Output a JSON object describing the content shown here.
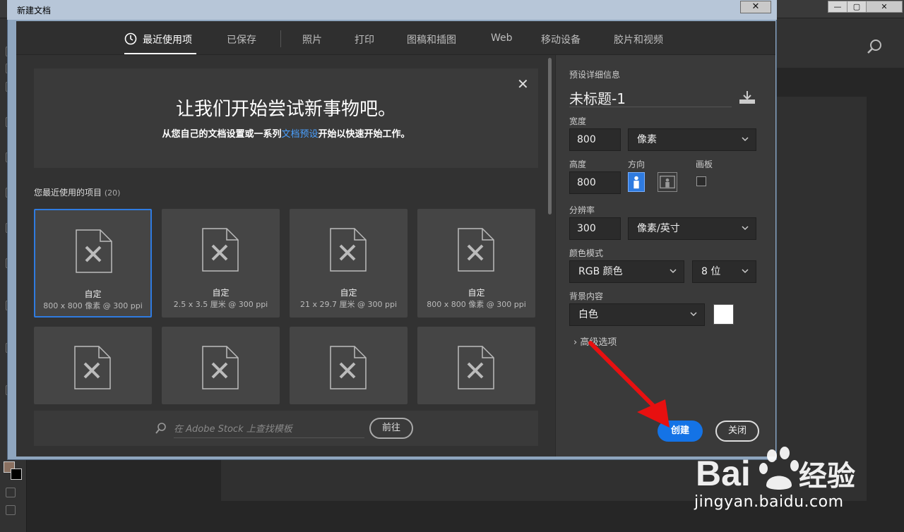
{
  "window": {
    "title": "新建文档",
    "close_label": "✕",
    "app_controls": [
      "—",
      "▢",
      "✕"
    ]
  },
  "tabs": [
    {
      "label": "最近使用项",
      "active": true
    },
    {
      "label": "已保存"
    },
    {
      "label": "照片"
    },
    {
      "label": "打印"
    },
    {
      "label": "图稿和插图"
    },
    {
      "label": "Web"
    },
    {
      "label": "移动设备"
    },
    {
      "label": "胶片和视频"
    }
  ],
  "welcome": {
    "title": "让我们开始尝试新事物吧。",
    "sub_before": "从您自己的文档设置或一系列",
    "sub_link": "文档预设",
    "sub_after": "开始以快速开始工作。",
    "close": "✕"
  },
  "recent": {
    "heading": "您最近使用的项目",
    "count": "(20)",
    "items": [
      {
        "name": "自定",
        "desc": "800 x 800 像素 @ 300 ppi",
        "selected": true
      },
      {
        "name": "自定",
        "desc": "2.5 x 3.5 厘米 @ 300 ppi"
      },
      {
        "name": "自定",
        "desc": "21 x 29.7 厘米 @ 300 ppi"
      },
      {
        "name": "自定",
        "desc": "800 x 800 像素 @ 300 ppi"
      },
      {
        "name": "",
        "desc": ""
      },
      {
        "name": "",
        "desc": ""
      },
      {
        "name": "",
        "desc": ""
      },
      {
        "name": "",
        "desc": ""
      }
    ]
  },
  "stock": {
    "placeholder": "在 Adobe Stock 上查找模板",
    "go_label": "前往"
  },
  "details": {
    "section": "预设详细信息",
    "name": "未标题-1",
    "width_label": "宽度",
    "width": "800",
    "width_unit": "像素",
    "height_label": "高度",
    "height": "800",
    "orientation_label": "方向",
    "artboard_label": "画板",
    "resolution_label": "分辨率",
    "resolution": "300",
    "resolution_unit": "像素/英寸",
    "color_mode_label": "颜色模式",
    "color_mode": "RGB 颜色",
    "bit_depth": "8 位",
    "bg_label": "背景内容",
    "bg_value": "白色",
    "bg_color": "#ffffff",
    "advanced_label": "高级选项"
  },
  "buttons": {
    "create": "创建",
    "close": "关闭"
  },
  "watermark": {
    "logo": "Bai 经验",
    "url": "jingyan.baidu.com"
  }
}
